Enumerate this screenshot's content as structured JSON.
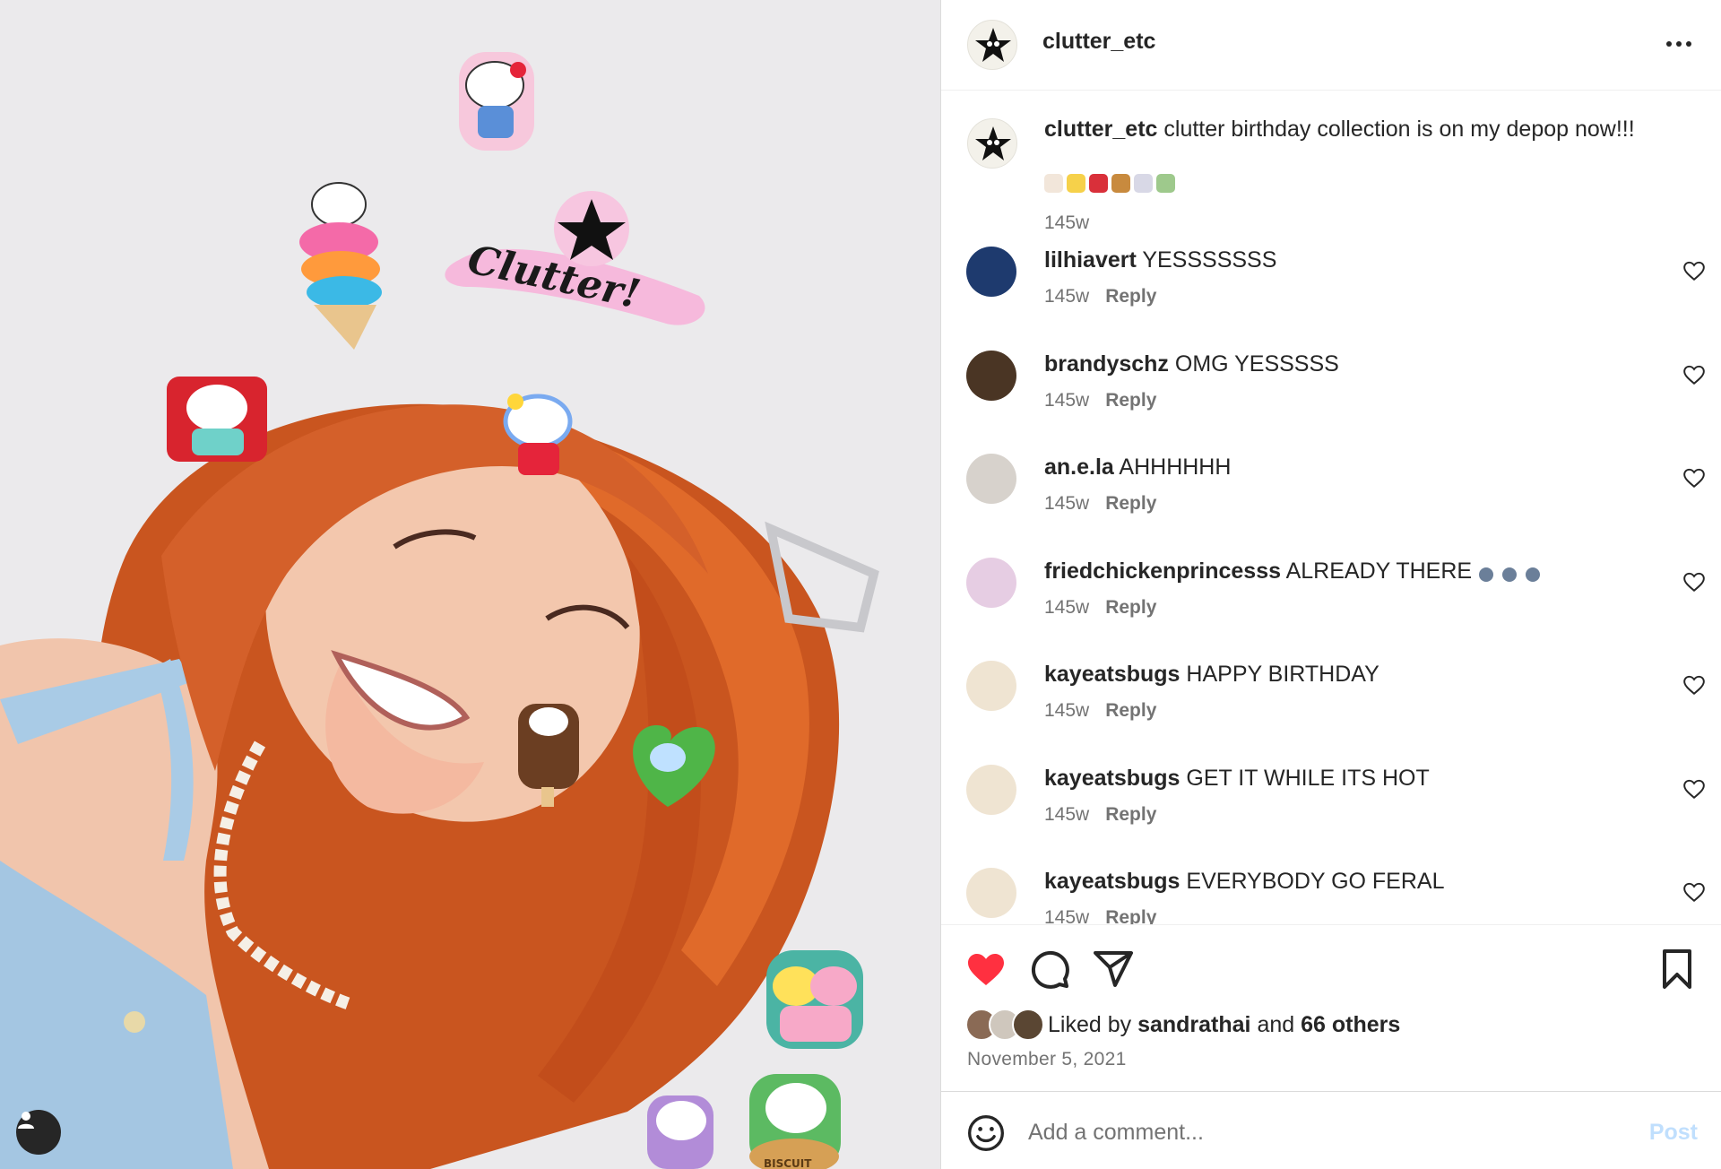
{
  "post": {
    "username": "clutter_etc",
    "caption_user": "clutter_etc",
    "caption_text": "clutter birthday collection is on my depop now!!!",
    "caption_emoji_icons": [
      "cake-icon",
      "banana-icon",
      "cherries-icon",
      "pie-icon",
      "magic-wand-icon",
      "money-wings-icon"
    ],
    "caption_time": "145w",
    "sticker_logo_text": "Clutter!",
    "sticker_biscuit_text": "BISCUIT"
  },
  "comments": [
    {
      "user": "lilhiavert",
      "text": "YESSSSSSS",
      "time": "145w",
      "reply": "Reply"
    },
    {
      "user": "brandyschz",
      "text": "OMG YESSSSS",
      "time": "145w",
      "reply": "Reply"
    },
    {
      "user": "an.e.la",
      "text": "AHHHHHH",
      "time": "145w",
      "reply": "Reply"
    },
    {
      "user": "friedchickenprincesss",
      "text": "ALREADY THERE",
      "time": "145w",
      "reply": "Reply"
    },
    {
      "user": "kayeatsbugs",
      "text": "HAPPY BIRTHDAY",
      "time": "145w",
      "reply": "Reply"
    },
    {
      "user": "kayeatsbugs",
      "text": "GET IT WHILE ITS HOT",
      "time": "145w",
      "reply": "Reply"
    },
    {
      "user": "kayeatsbugs",
      "text": "EVERYBODY GO FERAL",
      "time": "145w",
      "reply": "Reply"
    }
  ],
  "likes": {
    "prefix": "Liked by",
    "user": "sandrathai",
    "conj": "and",
    "others": "66 others"
  },
  "post_date": "November 5, 2021",
  "add_comment": {
    "placeholder": "Add a comment...",
    "post_label": "Post"
  },
  "colors": {
    "like_red": "#ff3040",
    "post_disabled": "#c0dffd",
    "hair": "#cf5a22",
    "text_secondary": "#737373"
  }
}
